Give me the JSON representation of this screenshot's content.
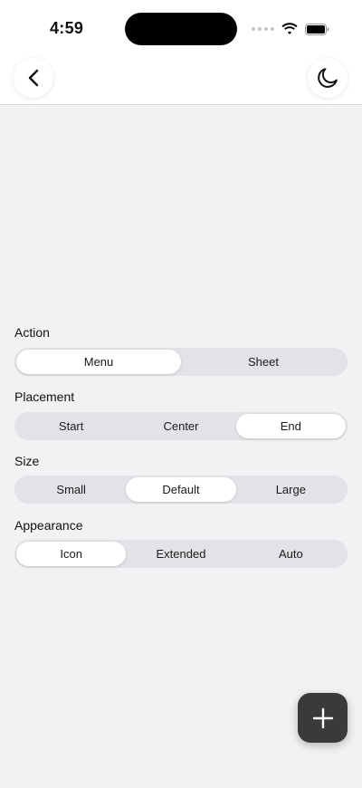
{
  "status_bar": {
    "time": "4:59"
  },
  "nav": {
    "back_icon": "chevron-left-icon",
    "theme_icon": "moon-icon"
  },
  "sections": [
    {
      "label": "Action",
      "options": [
        "Menu",
        "Sheet"
      ],
      "selected": 0
    },
    {
      "label": "Placement",
      "options": [
        "Start",
        "Center",
        "End"
      ],
      "selected": 2
    },
    {
      "label": "Size",
      "options": [
        "Small",
        "Default",
        "Large"
      ],
      "selected": 1
    },
    {
      "label": "Appearance",
      "options": [
        "Icon",
        "Extended",
        "Auto"
      ],
      "selected": 0
    }
  ],
  "fab": {
    "icon": "plus-icon"
  },
  "colors": {
    "background": "#f2f2f4",
    "segment_track": "#e3e3e7",
    "fab": "#3a3a3c"
  }
}
